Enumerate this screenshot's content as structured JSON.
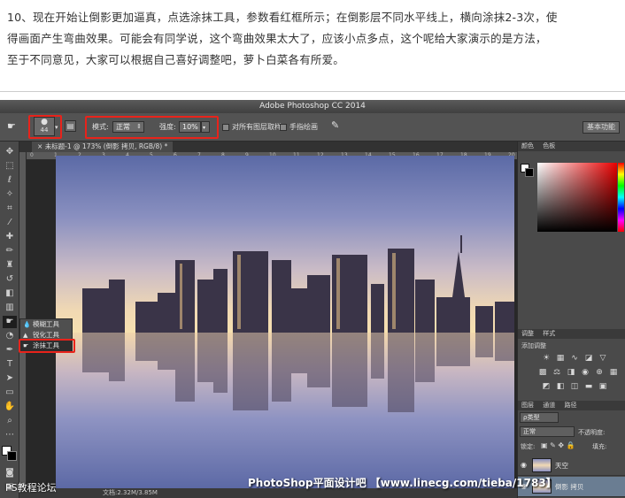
{
  "article": {
    "line1": "10、现在开始让倒影更加逼真，点选涂抹工具，参数看红框所示；在倒影层不同水平线上，横向涂抹2-3次，使",
    "line2": "得画面产生弯曲效果。可能会有同学说，这个弯曲效果太大了，应该小点多点，这个呢给大家演示的是方法，",
    "line3": "至于不同意见，大家可以根据自己喜好调整吧，萝卜白菜各有所爱。"
  },
  "app": {
    "title": "Adobe Photoshop CC 2014",
    "workspace": "基本功能"
  },
  "options": {
    "brush_size": "44",
    "mode_label": "模式:",
    "mode_value": "正常",
    "strength_label": "强度:",
    "strength_value": "10%",
    "sample_all_layers": "对所有图层取样",
    "finger_painting": "手指绘画"
  },
  "document": {
    "tab_title": "未标题-1 @ 173% (倒影 拷贝, RGB/8) *",
    "status": "文档:2.32M/3.85M"
  },
  "ruler": {
    "ticks": [
      "0",
      "1",
      "2",
      "3",
      "4",
      "5",
      "6",
      "7",
      "8",
      "9",
      "10",
      "11",
      "12",
      "13",
      "14",
      "15",
      "16",
      "17",
      "18",
      "19",
      "20"
    ]
  },
  "tool_submenu": {
    "items": [
      {
        "label": "模糊工具"
      },
      {
        "label": "锐化工具"
      },
      {
        "label": "涂抹工具"
      }
    ]
  },
  "panels": {
    "color_tab": "颜色",
    "swatches_tab": "色板",
    "adjust_tab": "调整",
    "styles_tab": "样式",
    "add_adjustment": "添加调整",
    "layers_tab": "图层",
    "channels_tab": "通道",
    "paths_tab": "路径",
    "kind_filter": "ρ类型",
    "blend_mode": "正常",
    "opacity_label": "不透明度:",
    "lock_label": "锁定:",
    "fill_label": "填充:",
    "layers": [
      {
        "name": "天空",
        "selected": false
      },
      {
        "name": "倒影 拷贝",
        "selected": true
      }
    ]
  },
  "watermarks": {
    "left": "PS教程论坛",
    "right": "PhotoShop平面设计吧 【www.linecg.com/tieba/1783】"
  }
}
